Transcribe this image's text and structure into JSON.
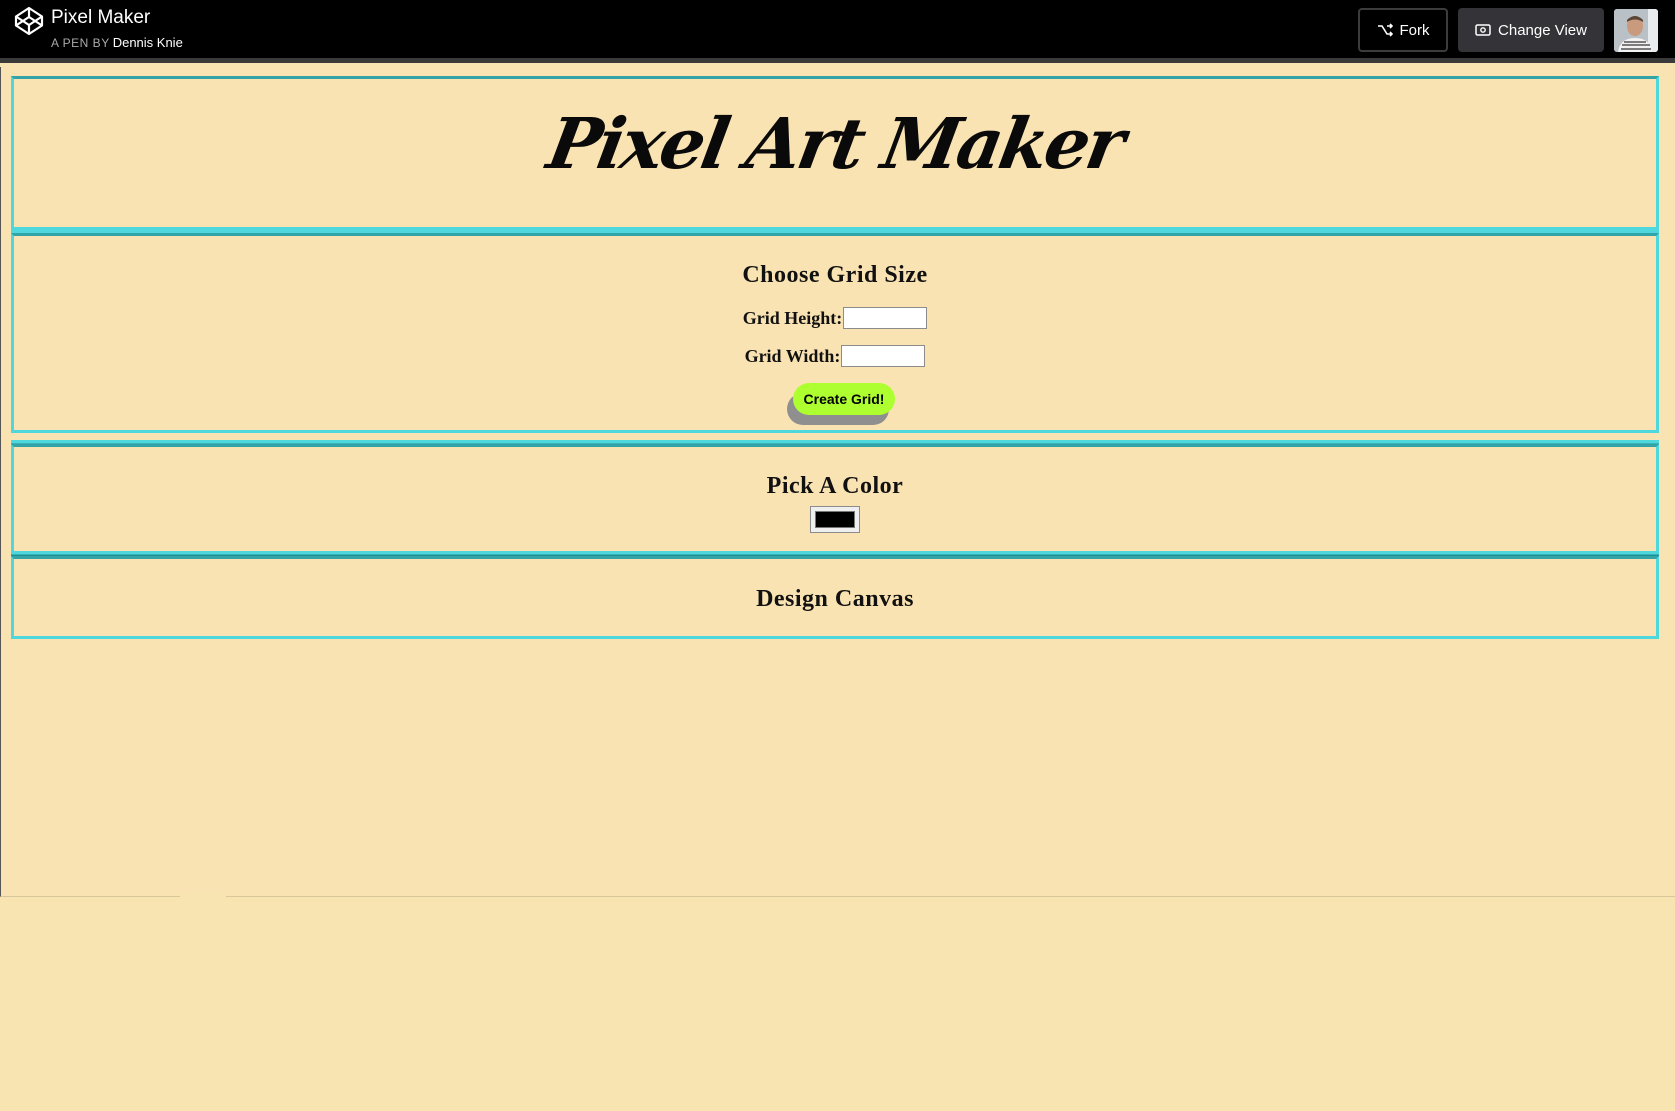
{
  "header": {
    "pen_title": "Pixel Maker",
    "pen_by_prefix": "A PEN BY",
    "author": "Dennis Knie",
    "fork_label": "Fork",
    "change_view_label": "Change View",
    "icons": [
      "codepen-logo-icon",
      "fork-icon",
      "change-view-icon",
      "user-avatar"
    ]
  },
  "app": {
    "title": "Pixel Art Maker",
    "grid_section": {
      "heading": "Choose Grid Size",
      "height_label": "Grid Height:",
      "height_value": "",
      "width_label": "Grid Width:",
      "width_value": "",
      "create_button": "Create Grid!"
    },
    "color_section": {
      "heading": "Pick A Color",
      "selected_color": "#000000"
    },
    "canvas_section": {
      "heading": "Design Canvas"
    }
  },
  "colors": {
    "page_background": "#fae3b2",
    "section_border": "#4ed8dd",
    "create_button": "#adff2f",
    "topbar": "#000000"
  }
}
